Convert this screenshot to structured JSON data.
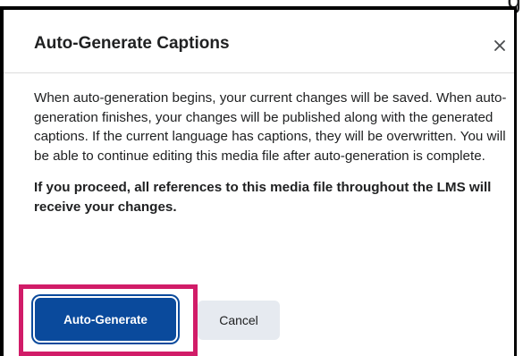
{
  "background_edge_text": "g",
  "dialog": {
    "title": "Auto-Generate Captions",
    "close_icon": "close-icon",
    "paragraph_1": "When auto-generation begins, your current changes will be saved. When auto-generation finishes, your changes will be published along with the generated captions. If the current language has captions, they will be overwritten. You will be able to continue editing this media file after auto-generation is complete.",
    "paragraph_2": "If you proceed, all references to this media file throughout the LMS will receive your changes.",
    "buttons": {
      "primary_label": "Auto-Generate",
      "secondary_label": "Cancel"
    }
  },
  "colors": {
    "primary_button": "#0a4a9c",
    "secondary_button": "#e6eaf0",
    "highlight_outline": "#d11c68",
    "text": "#202122"
  }
}
